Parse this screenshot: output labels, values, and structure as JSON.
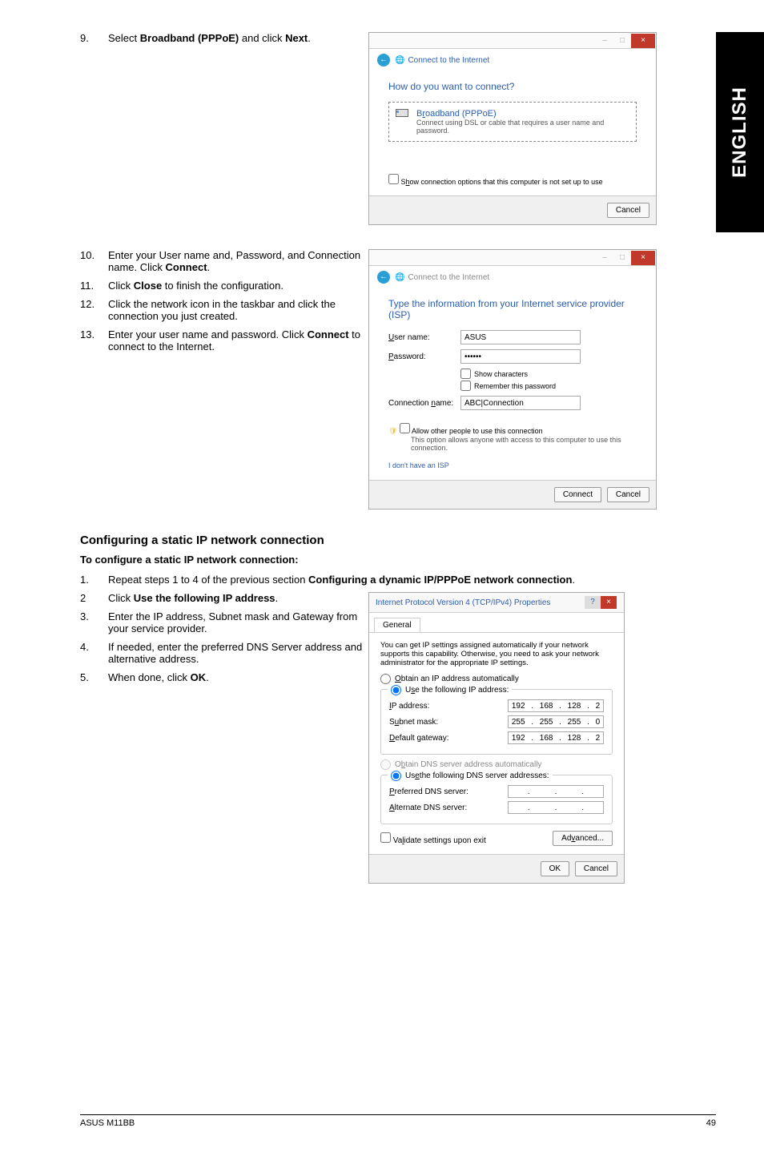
{
  "side_tab": "ENGLISH",
  "steps_top": [
    {
      "num": "9.",
      "text_pre": "Select ",
      "bold": "Broadband (PPPoE)",
      "text_mid": " and click ",
      "bold2": "Next",
      "text_post": "."
    }
  ],
  "steps_mid": [
    {
      "num": "10.",
      "text": "Enter your User name and, Password, and Connection name. Click ",
      "bold": "Connect",
      "post": "."
    },
    {
      "num": "11.",
      "text": "Click ",
      "bold": "Close",
      "post": " to finish the configuration."
    },
    {
      "num": "12.",
      "text": "Click the network icon in the taskbar and click the connection you just created.",
      "bold": "",
      "post": ""
    },
    {
      "num": "13.",
      "text": "Enter your user name and password. Click ",
      "bold": "Connect",
      "post": " to connect to the Internet."
    }
  ],
  "dialog1": {
    "crumb": "Connect to the Internet",
    "heading": "How do you want to connect?",
    "option_title_pre": "B",
    "option_title_u": "r",
    "option_title_post": "oadband (PPPoE)",
    "option_sub": "Connect using DSL or cable that requires a user name and password.",
    "check_pre": "S",
    "check_u": "h",
    "check_post": "ow connection options that this computer is not set up to use",
    "cancel": "Cancel"
  },
  "dialog2": {
    "crumb": "Connect to the Internet",
    "heading": "Type the information from your Internet service provider (ISP)",
    "username_lbl_u": "U",
    "username_lbl": "ser name:",
    "username_val": "ASUS",
    "password_lbl_u": "P",
    "password_lbl": "assword:",
    "password_val": "••••••",
    "show_chars_u": "S",
    "show_chars": "how characters",
    "remember_u": "R",
    "remember": "emember this password",
    "conn_lbl": "Connection ",
    "conn_lbl_u": "n",
    "conn_lbl2": "ame:",
    "conn_val": "ABC|Connection",
    "allow_u": "A",
    "allow": "llow other people to use this connection",
    "allow_sub": "This option allows anyone with access to this computer to use this connection.",
    "noisp": "I don't have an ISP",
    "connect": "Connect",
    "cancel": "Cancel"
  },
  "section_heading": "Configuring a static IP network connection",
  "section_sub": "To configure a static IP network connection:",
  "steps_bottom": [
    {
      "num": "1.",
      "text": "Repeat steps 1 to 4 of the previous section ",
      "bold": "Configuring a dynamic IP/PPPoE network connection",
      "post": "."
    },
    {
      "num": "2",
      "text": "Click ",
      "bold": "Use the following IP address",
      "post": "."
    },
    {
      "num": "3.",
      "text": "Enter the IP address, Subnet mask and Gateway from your service provider.",
      "bold": "",
      "post": ""
    },
    {
      "num": "4.",
      "text": "If needed, enter the preferred DNS Server address and alternative address.",
      "bold": "",
      "post": ""
    },
    {
      "num": "5.",
      "text": "When done, click ",
      "bold": "OK",
      "post": "."
    }
  ],
  "props": {
    "title": "Internet Protocol Version 4 (TCP/IPv4) Properties",
    "tab": "General",
    "desc": "You can get IP settings assigned automatically if your network supports this capability. Otherwise, you need to ask your network administrator for the appropriate IP settings.",
    "obtain_ip_u": "O",
    "obtain_ip": "btain an IP address automatically",
    "use_ip": "U",
    "use_ip_u": "s",
    "use_ip2": "e the following IP address:",
    "ip_lbl_u": "I",
    "ip_lbl": "P address:",
    "ip_val": [
      "192",
      "168",
      "128",
      "2"
    ],
    "subnet_lbl": "S",
    "subnet_lbl_u": "u",
    "subnet_lbl2": "bnet mask:",
    "subnet_val": [
      "255",
      "255",
      "255",
      "0"
    ],
    "gw_lbl_u": "D",
    "gw_lbl": "efault gateway:",
    "gw_val": [
      "192",
      "168",
      "128",
      "2"
    ],
    "obtain_dns": "O",
    "obtain_dns_u": "b",
    "obtain_dns2": "tain DNS server address automatically",
    "use_dns": "Us",
    "use_dns_u": "e",
    "use_dns2": " the following DNS server addresses:",
    "pref_dns_u": "P",
    "pref_dns": "referred DNS server:",
    "alt_dns_u": "A",
    "alt_dns": "lternate DNS server:",
    "validate": "Va",
    "validate_u": "l",
    "validate2": "idate settings upon exit",
    "advanced": "Ad",
    "advanced_u": "v",
    "advanced2": "anced...",
    "ok": "OK",
    "cancel": "Cancel"
  },
  "footer_left": "ASUS M11BB",
  "footer_right": "49"
}
